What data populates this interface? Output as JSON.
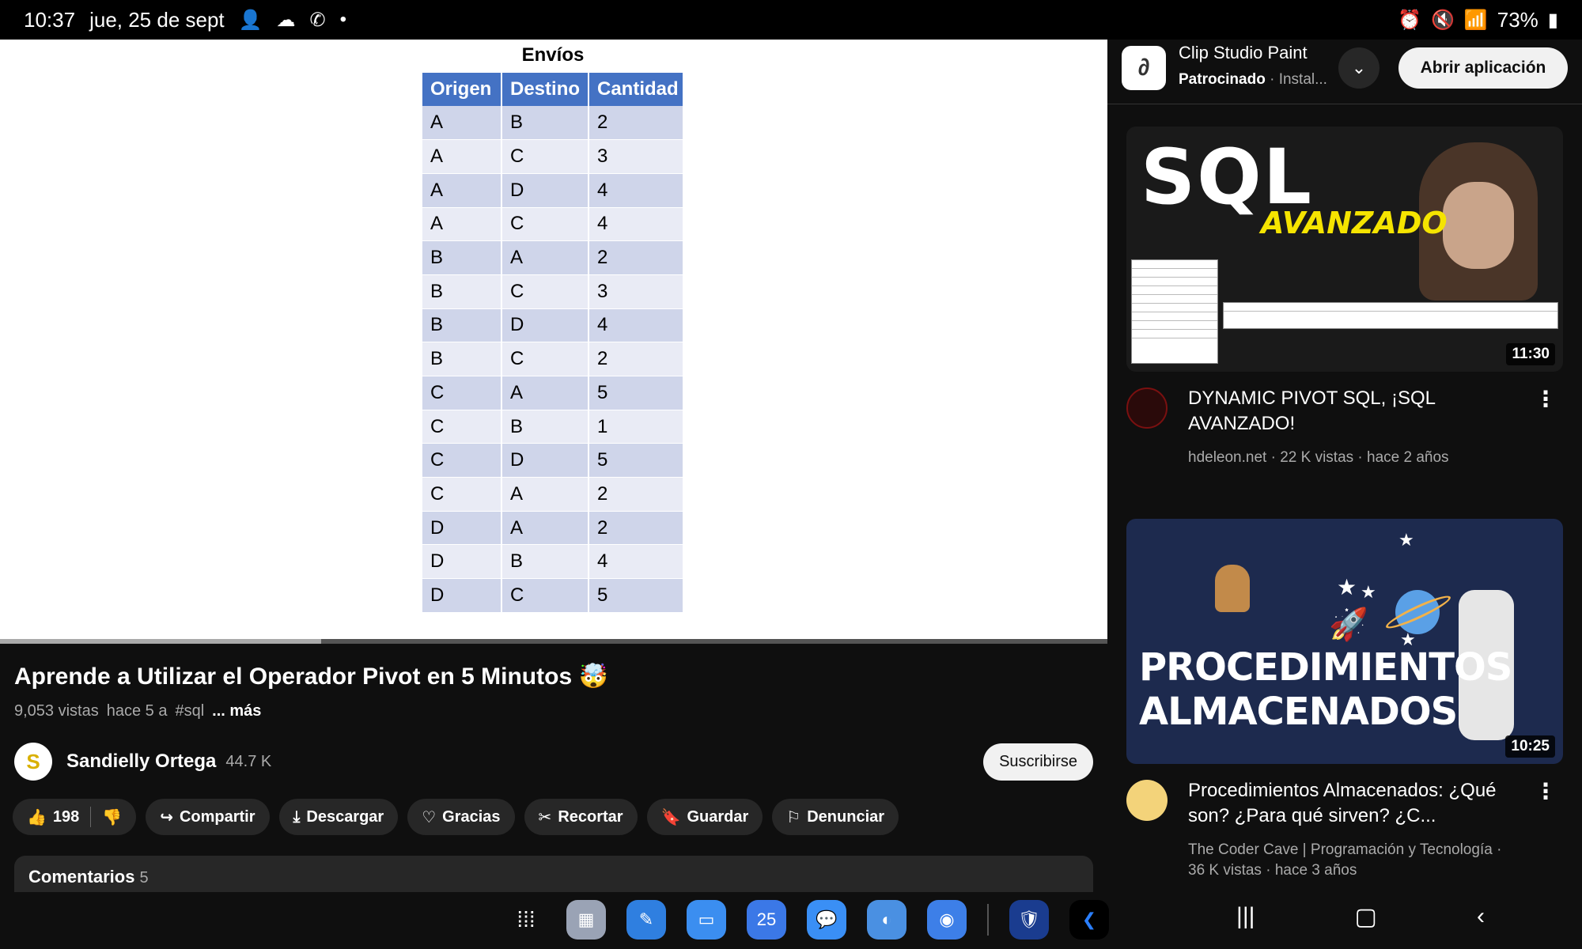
{
  "status_bar": {
    "time": "10:37",
    "date": "jue, 25 de sept",
    "dot": "•",
    "battery": "73%"
  },
  "slide": {
    "title": "Envíos",
    "headers": [
      "Origen",
      "Destino",
      "Cantidad"
    ],
    "rows": [
      [
        "A",
        "B",
        "2"
      ],
      [
        "A",
        "C",
        "3"
      ],
      [
        "A",
        "D",
        "4"
      ],
      [
        "A",
        "C",
        "4"
      ],
      [
        "B",
        "A",
        "2"
      ],
      [
        "B",
        "C",
        "3"
      ],
      [
        "B",
        "D",
        "4"
      ],
      [
        "B",
        "C",
        "2"
      ],
      [
        "C",
        "A",
        "5"
      ],
      [
        "C",
        "B",
        "1"
      ],
      [
        "C",
        "D",
        "5"
      ],
      [
        "C",
        "A",
        "2"
      ],
      [
        "D",
        "A",
        "2"
      ],
      [
        "D",
        "B",
        "4"
      ],
      [
        "D",
        "C",
        "5"
      ]
    ]
  },
  "player": {
    "progress_fraction": 0.29
  },
  "video": {
    "title": "Aprende a Utilizar el Operador Pivot en 5 Minutos",
    "title_emoji": "🤯",
    "views": "9,053 vistas",
    "age": "hace 5 a",
    "hashtag": "#sql",
    "more": "... más"
  },
  "channel": {
    "name": "Sandielly Ortega",
    "subscribers": "44.7 K",
    "subscribe_label": "Suscribirse"
  },
  "actions": {
    "likes": "198",
    "share": "Compartir",
    "download": "Descargar",
    "thanks": "Gracias",
    "clip": "Recortar",
    "save": "Guardar",
    "report": "Denunciar"
  },
  "comments": {
    "label": "Comentarios",
    "count": "5"
  },
  "ad": {
    "title": "Clip Studio Paint",
    "sponsored": "Patrocinado",
    "install": "· Instal...",
    "open_label": "Abrir aplicación"
  },
  "recommendations": [
    {
      "thumb_text_1": "SQL",
      "thumb_text_2": "AVANZADO",
      "duration": "11:30",
      "title": "DYNAMIC PIVOT SQL, ¡SQL AVANZADO!",
      "meta": "hdeleon.net · 22 K vistas · hace 2 años"
    },
    {
      "thumb_text_1": "PROCEDIMIENTOS",
      "thumb_text_2": "ALMACENADOS",
      "duration": "10:25",
      "title": "Procedimientos Almacenados: ¿Qué son? ¿Para qué sirven? ¿C...",
      "meta_1": "The Coder Cave | Programación y Tecnología ·",
      "meta_2": "36 K vistas · hace 3 años"
    }
  ],
  "dock": {
    "calendar_day": "25"
  },
  "icons": {
    "like": "thumbs-up-icon",
    "dislike": "thumbs-down-icon",
    "share": "share-icon",
    "download": "download-icon",
    "thanks": "heart-dollar-icon",
    "clip": "scissors-icon",
    "save": "bookmark-icon",
    "report": "flag-icon"
  },
  "colors": {
    "table_header": "#4472c4",
    "accent_red": "#ff0000",
    "background": "#0f0f0f"
  }
}
